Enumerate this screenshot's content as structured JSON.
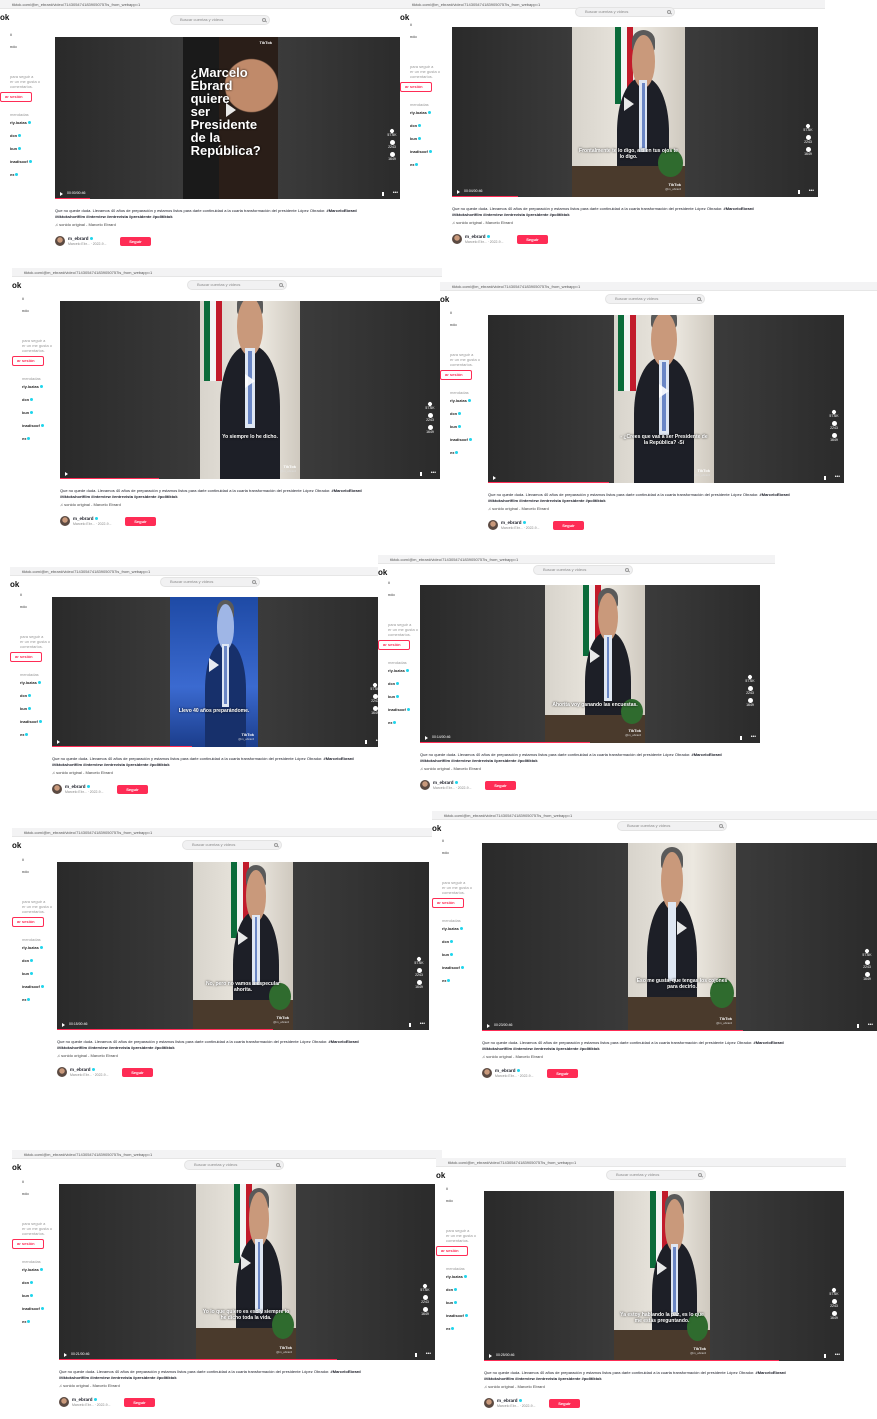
{
  "browser": {
    "url": "tiktok.com/@m_ebrard/video/7143054741839050757is_from_webapp=1"
  },
  "brand": "ok",
  "search": {
    "placeholder": "Buscar cuentas y videos"
  },
  "sidebar": {
    "items": [
      "ii",
      "ndo"
    ],
    "prompt": [
      "para seguir a",
      "er un me gusta o",
      "comentarios."
    ],
    "login": "ar sesión",
    "heading": "mendadas",
    "accounts": [
      "rly.lozias",
      "dcn",
      "kun",
      "inadisoof",
      "ex"
    ]
  },
  "video": {
    "caption": "Que no quede duda. Llevamos 40 años de preparación y estamos listos para darle continuidad a la cuarta transformación del presidente López Obrador.",
    "caption_tag": "#MarceloEbrard",
    "hashtags": "#tiktokshortfilm #interview #entrevista #presidente #politiktok",
    "sound": "sonido original - Marcelo Ebrard",
    "watermark": "TikTok",
    "handle": "@m_ebrard",
    "likes": "57.6K",
    "comments": "2243",
    "shares": "1649",
    "more": "•••"
  },
  "author": {
    "name": "m_ebrard",
    "meta": "Marcelo Ebr...  · 2022-9...",
    "follow": "Seguir"
  },
  "title_card": [
    "¿Marcelo",
    "Ebrard",
    "quiere",
    "ser",
    "Presidente",
    "de la",
    "República?"
  ],
  "frames": [
    {
      "time": "00:00/00:46",
      "subtitle": ""
    },
    {
      "time": "00:04/00:46",
      "subtitle": "Frontalmente te lo digo, a ti en tus ojos te lo digo."
    },
    {
      "time": "",
      "subtitle": "Yo siempre lo he dicho."
    },
    {
      "time": "",
      "subtitle": "- ¿Crees que vas a ser Presidente de la República? -Sí"
    },
    {
      "time": "",
      "subtitle": "Llevo 40 años preparándome."
    },
    {
      "time": "00:14/00:46",
      "subtitle": "Ahorita voy ganando las encuestas."
    },
    {
      "time": "00:15/00:46",
      "subtitle": "No, pero no vamos a especular ahorita."
    },
    {
      "time": "00:23/00:46",
      "subtitle": "Eso me gusta, que tengas los cojones para decirlo."
    },
    {
      "time": "00:21/00:46",
      "subtitle": "Yo lo que quiero es eso y siempre lo he dicho toda la vida."
    },
    {
      "time": "00:25/00:46",
      "subtitle": "Ya estoy hablando la paz, es lo que me estás preguntando."
    }
  ]
}
